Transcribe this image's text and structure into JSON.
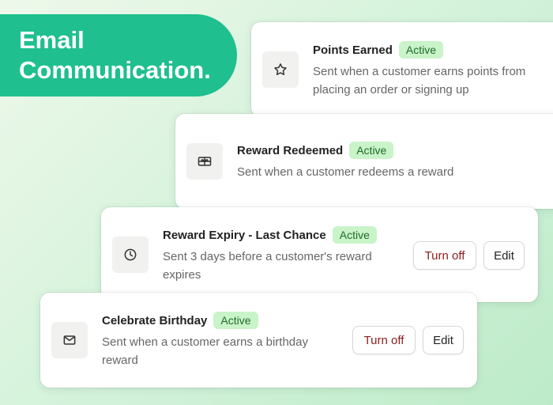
{
  "hero": {
    "line1": "Email",
    "line2": "Communication."
  },
  "cards": [
    {
      "title": "Points Earned",
      "status": "Active",
      "desc_line1": "Sent when a customer earns points from",
      "desc_line2": "placing an order or signing up",
      "icon": "star-icon"
    },
    {
      "title": "Reward Redeemed",
      "status": "Active",
      "desc_line1": "Sent when a customer redeems a reward",
      "icon": "gift-card-icon"
    },
    {
      "title": "Reward Expiry - Last Chance",
      "status": "Active",
      "desc_line1": "Sent 3 days before a customer's reward",
      "desc_line2": "expires",
      "icon": "clock-icon",
      "turn_off_label": "Turn off",
      "edit_label": "Edit"
    },
    {
      "title": "Celebrate Birthday",
      "status": "Active",
      "desc_line1": "Sent when a customer earns a birthday",
      "desc_line2": "reward",
      "icon": "envelope-icon",
      "turn_off_label": "Turn off",
      "edit_label": "Edit"
    }
  ],
  "colors": {
    "hero_bg": "#1fbf8f",
    "badge_bg": "#c9f3c8",
    "badge_text": "#1f6b2b",
    "turn_off_text": "#8a1d1d"
  }
}
